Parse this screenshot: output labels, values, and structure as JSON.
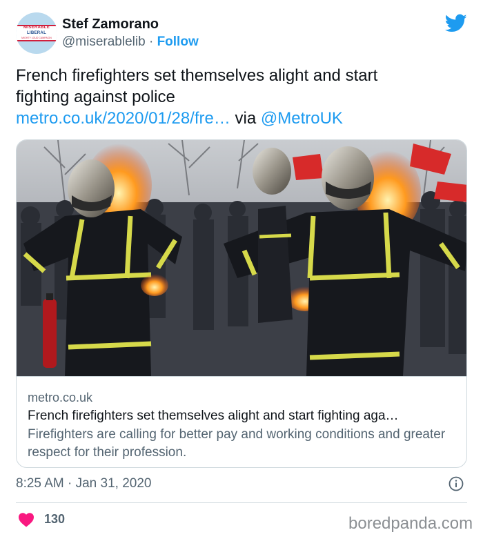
{
  "tweet": {
    "author": {
      "display_name": "Stef Zamorano",
      "handle": "@miserablelib",
      "separator": "·",
      "follow_label": "Follow",
      "avatar_text": [
        "MISERABLE",
        "LIBERAL",
        "MIGHTY LOUD CAMPAIGN"
      ]
    },
    "text_line_1": "French firefighters set themselves alight and start",
    "text_line_2": "fighting against police",
    "link_text": "metro.co.uk/2020/01/28/fre…",
    "via_text": " via ",
    "mention": "@MetroUK",
    "card": {
      "domain": "metro.co.uk",
      "title": "French firefighters set themselves alight and start fighting aga…",
      "description": "Firefighters are calling for better pay and working conditions and greater respect for their profession."
    },
    "timestamp": "8:25 AM · Jan 31, 2020",
    "like_count": "130"
  },
  "watermark": "boredpanda.com",
  "colors": {
    "link": "#1d9bf0",
    "heart": "#f91880",
    "secondary_text": "#536471",
    "border": "#cfd9de"
  },
  "icons": [
    "twitter-bird-icon",
    "info-icon",
    "heart-icon"
  ]
}
